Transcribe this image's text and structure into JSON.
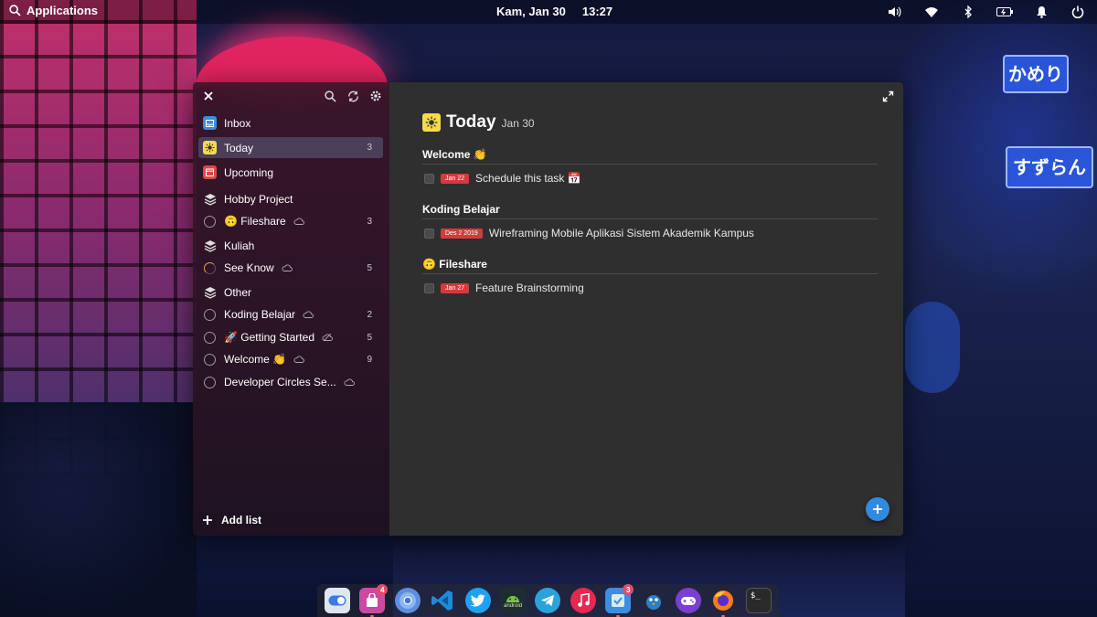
{
  "top_panel": {
    "applications_label": "Applications",
    "date": "Kam, Jan 30",
    "time": "13:27",
    "indicators": [
      "volume-icon",
      "wifi-icon",
      "bluetooth-icon",
      "battery-icon",
      "notifications-icon",
      "power-icon"
    ]
  },
  "sidebar": {
    "smart_lists": [
      {
        "label": "Inbox",
        "icon": "inbox-icon",
        "color": "#3d8de0",
        "count": ""
      },
      {
        "label": "Today",
        "icon": "sun-icon",
        "color": "#f7d94c",
        "count": "3"
      },
      {
        "label": "Upcoming",
        "icon": "calendar-icon",
        "color": "#e0473f",
        "count": ""
      }
    ],
    "groups": [
      {
        "name": "Hobby Project",
        "lists": [
          {
            "label": "🙃 Fileshare",
            "count": "3"
          }
        ]
      },
      {
        "name": "Kuliah",
        "lists": [
          {
            "label": "See Know",
            "count": "5"
          }
        ]
      },
      {
        "name": "Other",
        "lists": [
          {
            "label": "Koding Belajar",
            "count": "2"
          },
          {
            "label": "🚀 Getting Started",
            "count": "5"
          },
          {
            "label": "Welcome 👏",
            "count": "9"
          },
          {
            "label": "Developer Circles Se...",
            "count": ""
          }
        ]
      }
    ],
    "add_list_label": "Add list"
  },
  "main": {
    "title": "Today",
    "date": "Jan 30",
    "sections": [
      {
        "title": "Welcome 👏",
        "tasks": [
          {
            "due": "Jan 22",
            "text": "Schedule this task 📅"
          }
        ]
      },
      {
        "title": "Koding Belajar",
        "tasks": [
          {
            "due": "Des  2 2019",
            "text": "Wireframing Mobile Aplikasi Sistem Akademik Kampus"
          }
        ]
      },
      {
        "title": "🙃 Fileshare",
        "tasks": [
          {
            "due": "Jan 27",
            "text": "Feature Brainstorming"
          }
        ]
      }
    ]
  },
  "dock": {
    "apps": [
      {
        "name": "settings",
        "badge": ""
      },
      {
        "name": "appcenter",
        "badge": "4"
      },
      {
        "name": "chromium",
        "badge": ""
      },
      {
        "name": "vscode",
        "badge": ""
      },
      {
        "name": "twitter",
        "badge": ""
      },
      {
        "name": "android",
        "badge": ""
      },
      {
        "name": "telegram",
        "badge": ""
      },
      {
        "name": "music",
        "badge": ""
      },
      {
        "name": "tasks",
        "badge": "3"
      },
      {
        "name": "bird",
        "badge": ""
      },
      {
        "name": "games",
        "badge": ""
      },
      {
        "name": "firefox",
        "badge": ""
      },
      {
        "name": "terminal",
        "badge": ""
      }
    ],
    "android_label": "android",
    "terminal_label": "$_"
  },
  "wallpaper": {
    "sign_a": "かめり",
    "sign_b": "すずらん"
  }
}
